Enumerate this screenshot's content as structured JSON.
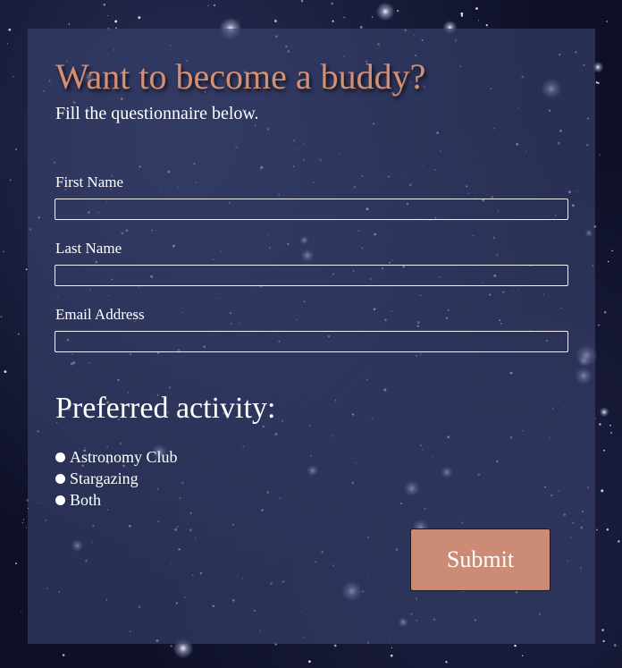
{
  "form": {
    "title": "Want to become a buddy?",
    "subtitle": "Fill the questionnaire below.",
    "fields": [
      {
        "label": "First Name",
        "value": "",
        "placeholder": ""
      },
      {
        "label": "Last Name",
        "value": "",
        "placeholder": ""
      },
      {
        "label": "Email Address",
        "value": "",
        "placeholder": ""
      }
    ],
    "activity": {
      "heading": "Preferred activity:",
      "options": [
        "Astronomy Club",
        "Stargazing",
        "Both"
      ]
    },
    "submit_label": "Submit"
  },
  "colors": {
    "title": "#d58f72",
    "button": "#cc8b74",
    "card": "#3a4470",
    "background": "#0e1028"
  }
}
